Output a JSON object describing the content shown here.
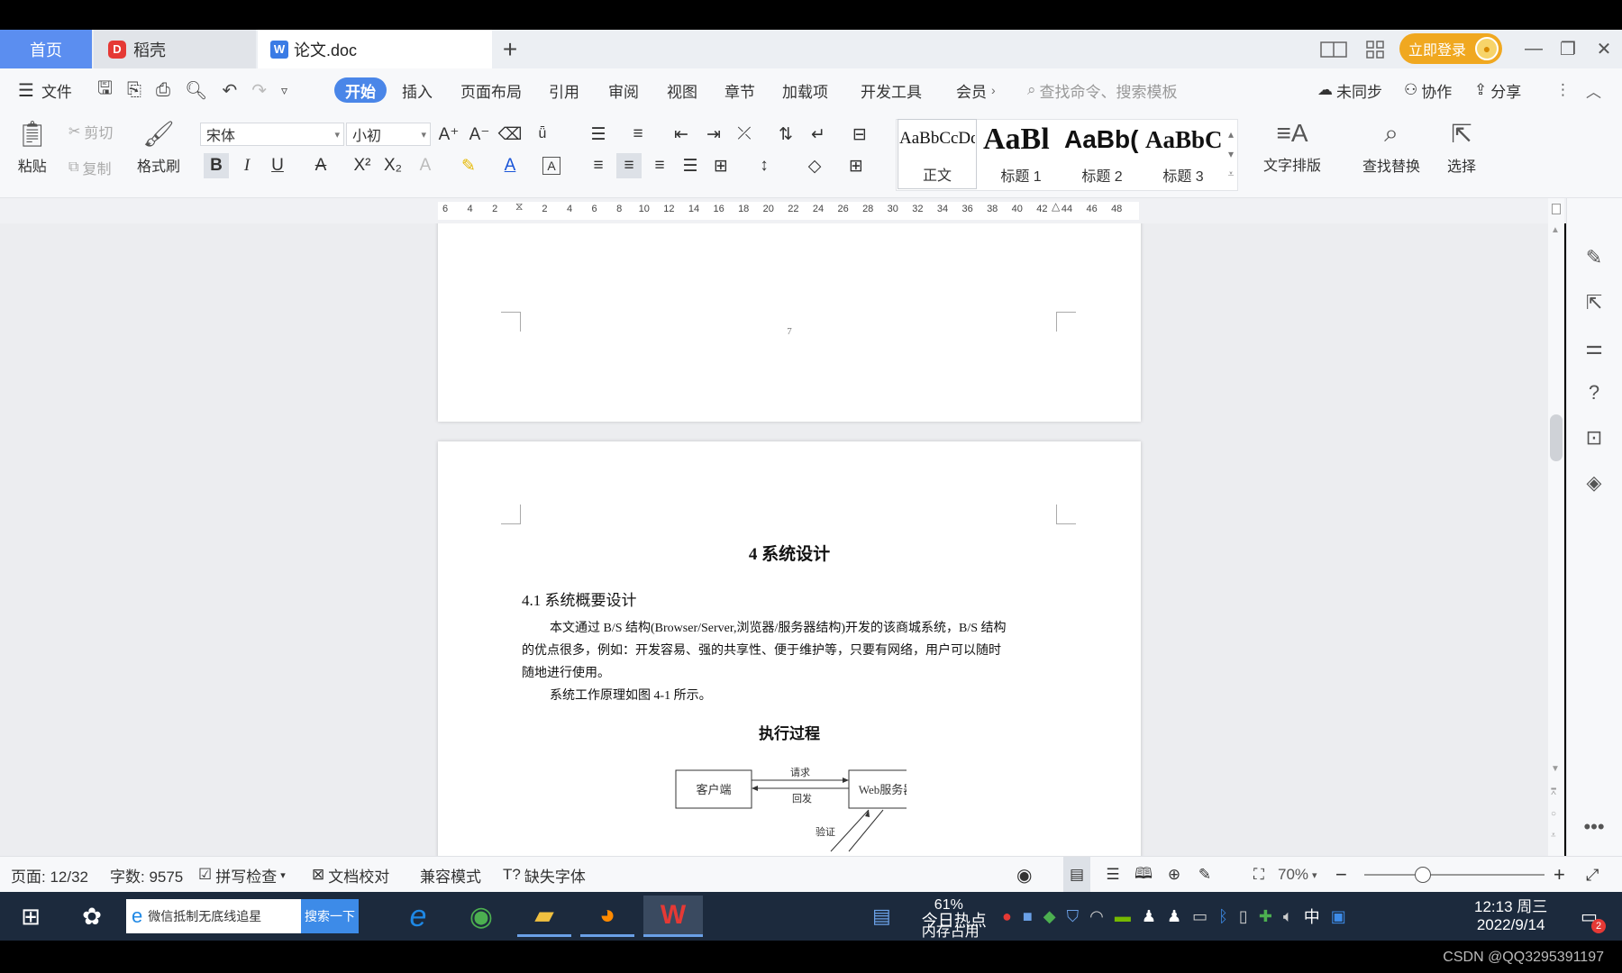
{
  "tabs": {
    "home": "首页",
    "docer": "稻壳",
    "doc": "论文.doc",
    "new_tab": "+",
    "login": "立即登录"
  },
  "menu": {
    "file": "文件",
    "items": [
      "开始",
      "插入",
      "页面布局",
      "引用",
      "审阅",
      "视图",
      "章节",
      "加载项",
      "开发工具",
      "会员"
    ],
    "search_placeholder": "查找命令、搜索模板",
    "sync": "未同步",
    "collab": "协作",
    "share": "分享"
  },
  "ribbon": {
    "paste": "粘贴",
    "cut": "剪切",
    "copy": "复制",
    "format_painter": "格式刷",
    "font_name": "宋体",
    "font_size": "小初",
    "styles": [
      {
        "sample": "AaBbCcDd",
        "label": "正文"
      },
      {
        "sample": "AaBl",
        "label": "标题 1"
      },
      {
        "sample": "AaBb(",
        "label": "标题 2"
      },
      {
        "sample": "AaBbC(",
        "label": "标题 3"
      }
    ],
    "text_layout": "文字排版",
    "find_replace": "查找替换",
    "select": "选择"
  },
  "ruler": {
    "ticks": [
      "6",
      "4",
      "2",
      "",
      "2",
      "4",
      "6",
      "8",
      "10",
      "12",
      "14",
      "16",
      "18",
      "20",
      "22",
      "24",
      "26",
      "28",
      "30",
      "32",
      "34",
      "36",
      "38",
      "40",
      "42",
      "44",
      "46",
      "48"
    ]
  },
  "document": {
    "page_number": "7",
    "chapter_title": "4  系统设计",
    "section_title": "4.1  系统概要设计",
    "para1_line1": "本文通过 B/S 结构(Browser/Server,浏览器/服务器结构)开发的该商城系统，B/S 结构",
    "para1_line2": "的优点很多，例如：开发容易、强的共享性、便于维护等，只要有网络，用户可以随时",
    "para1_line3": "随地进行使用。",
    "para2": "系统工作原理如图 4-1 所示。",
    "figure_title": "执行过程",
    "diagram": {
      "client": "客户端",
      "server": "Web服务器",
      "request": "请求",
      "reply": "回发",
      "verify": "验证"
    }
  },
  "status": {
    "page": "页面: 12/32",
    "word_count": "字数: 9575",
    "spell_check": "拼写检查",
    "doc_proof": "文档校对",
    "compat_mode": "兼容模式",
    "missing_font": "缺失字体",
    "zoom": "70%"
  },
  "taskbar": {
    "search_text": "微信抵制无底线追星",
    "search_button": "搜索一下",
    "memory_percent": "61%",
    "memory_label": "内存占用",
    "hot_news": "今日热点",
    "ime": "中",
    "time": "12:13 周三",
    "date": "2022/9/14",
    "notification_count": "2"
  },
  "watermark": "CSDN @QQ3295391197",
  "colors": {
    "accent": "#4a86e8",
    "login": "#f0a820",
    "taskbar": "#1c2a3d"
  }
}
